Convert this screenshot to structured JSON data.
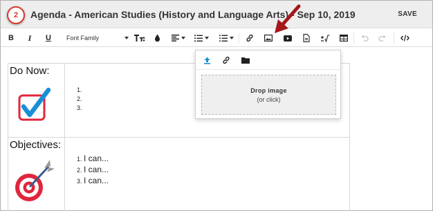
{
  "header": {
    "step_number": "2",
    "title": "Agenda - American Studies (History and Language Arts) - Sep 10, 2019",
    "save_label": "SAVE"
  },
  "toolbar": {
    "bold": "B",
    "italic": "I",
    "underline": "U",
    "font_family": "Font Family",
    "font_size_label": "T",
    "icons": [
      "bold-icon",
      "italic-icon",
      "underline-icon",
      "font-family-select",
      "font-size-icon",
      "text-color-icon",
      "align-icon",
      "ordered-list-icon",
      "unordered-list-icon",
      "link-icon",
      "image-icon",
      "video-icon",
      "file-icon",
      "formula-icon",
      "table-icon",
      "undo-icon",
      "redo-icon",
      "code-view-icon"
    ]
  },
  "image_popup": {
    "tabs": [
      "upload-icon",
      "link-icon",
      "folder-icon"
    ],
    "active_tab": "upload-icon",
    "drop_title": "Drop image",
    "drop_subtitle": "(or click)"
  },
  "agenda": {
    "rows": [
      {
        "label": "Do Now:",
        "icon": "checkbox-check-icon",
        "items": [
          "",
          "",
          ""
        ]
      },
      {
        "label": "Objectives:",
        "icon": "target-icon",
        "items": [
          "I can...",
          "I can...",
          "I can..."
        ]
      }
    ]
  },
  "colors": {
    "accent_blue": "#1a8fd6",
    "badge_red": "#d83a2e",
    "arrow_red": "#a3181a",
    "checkbox_red": "#e0263b"
  }
}
